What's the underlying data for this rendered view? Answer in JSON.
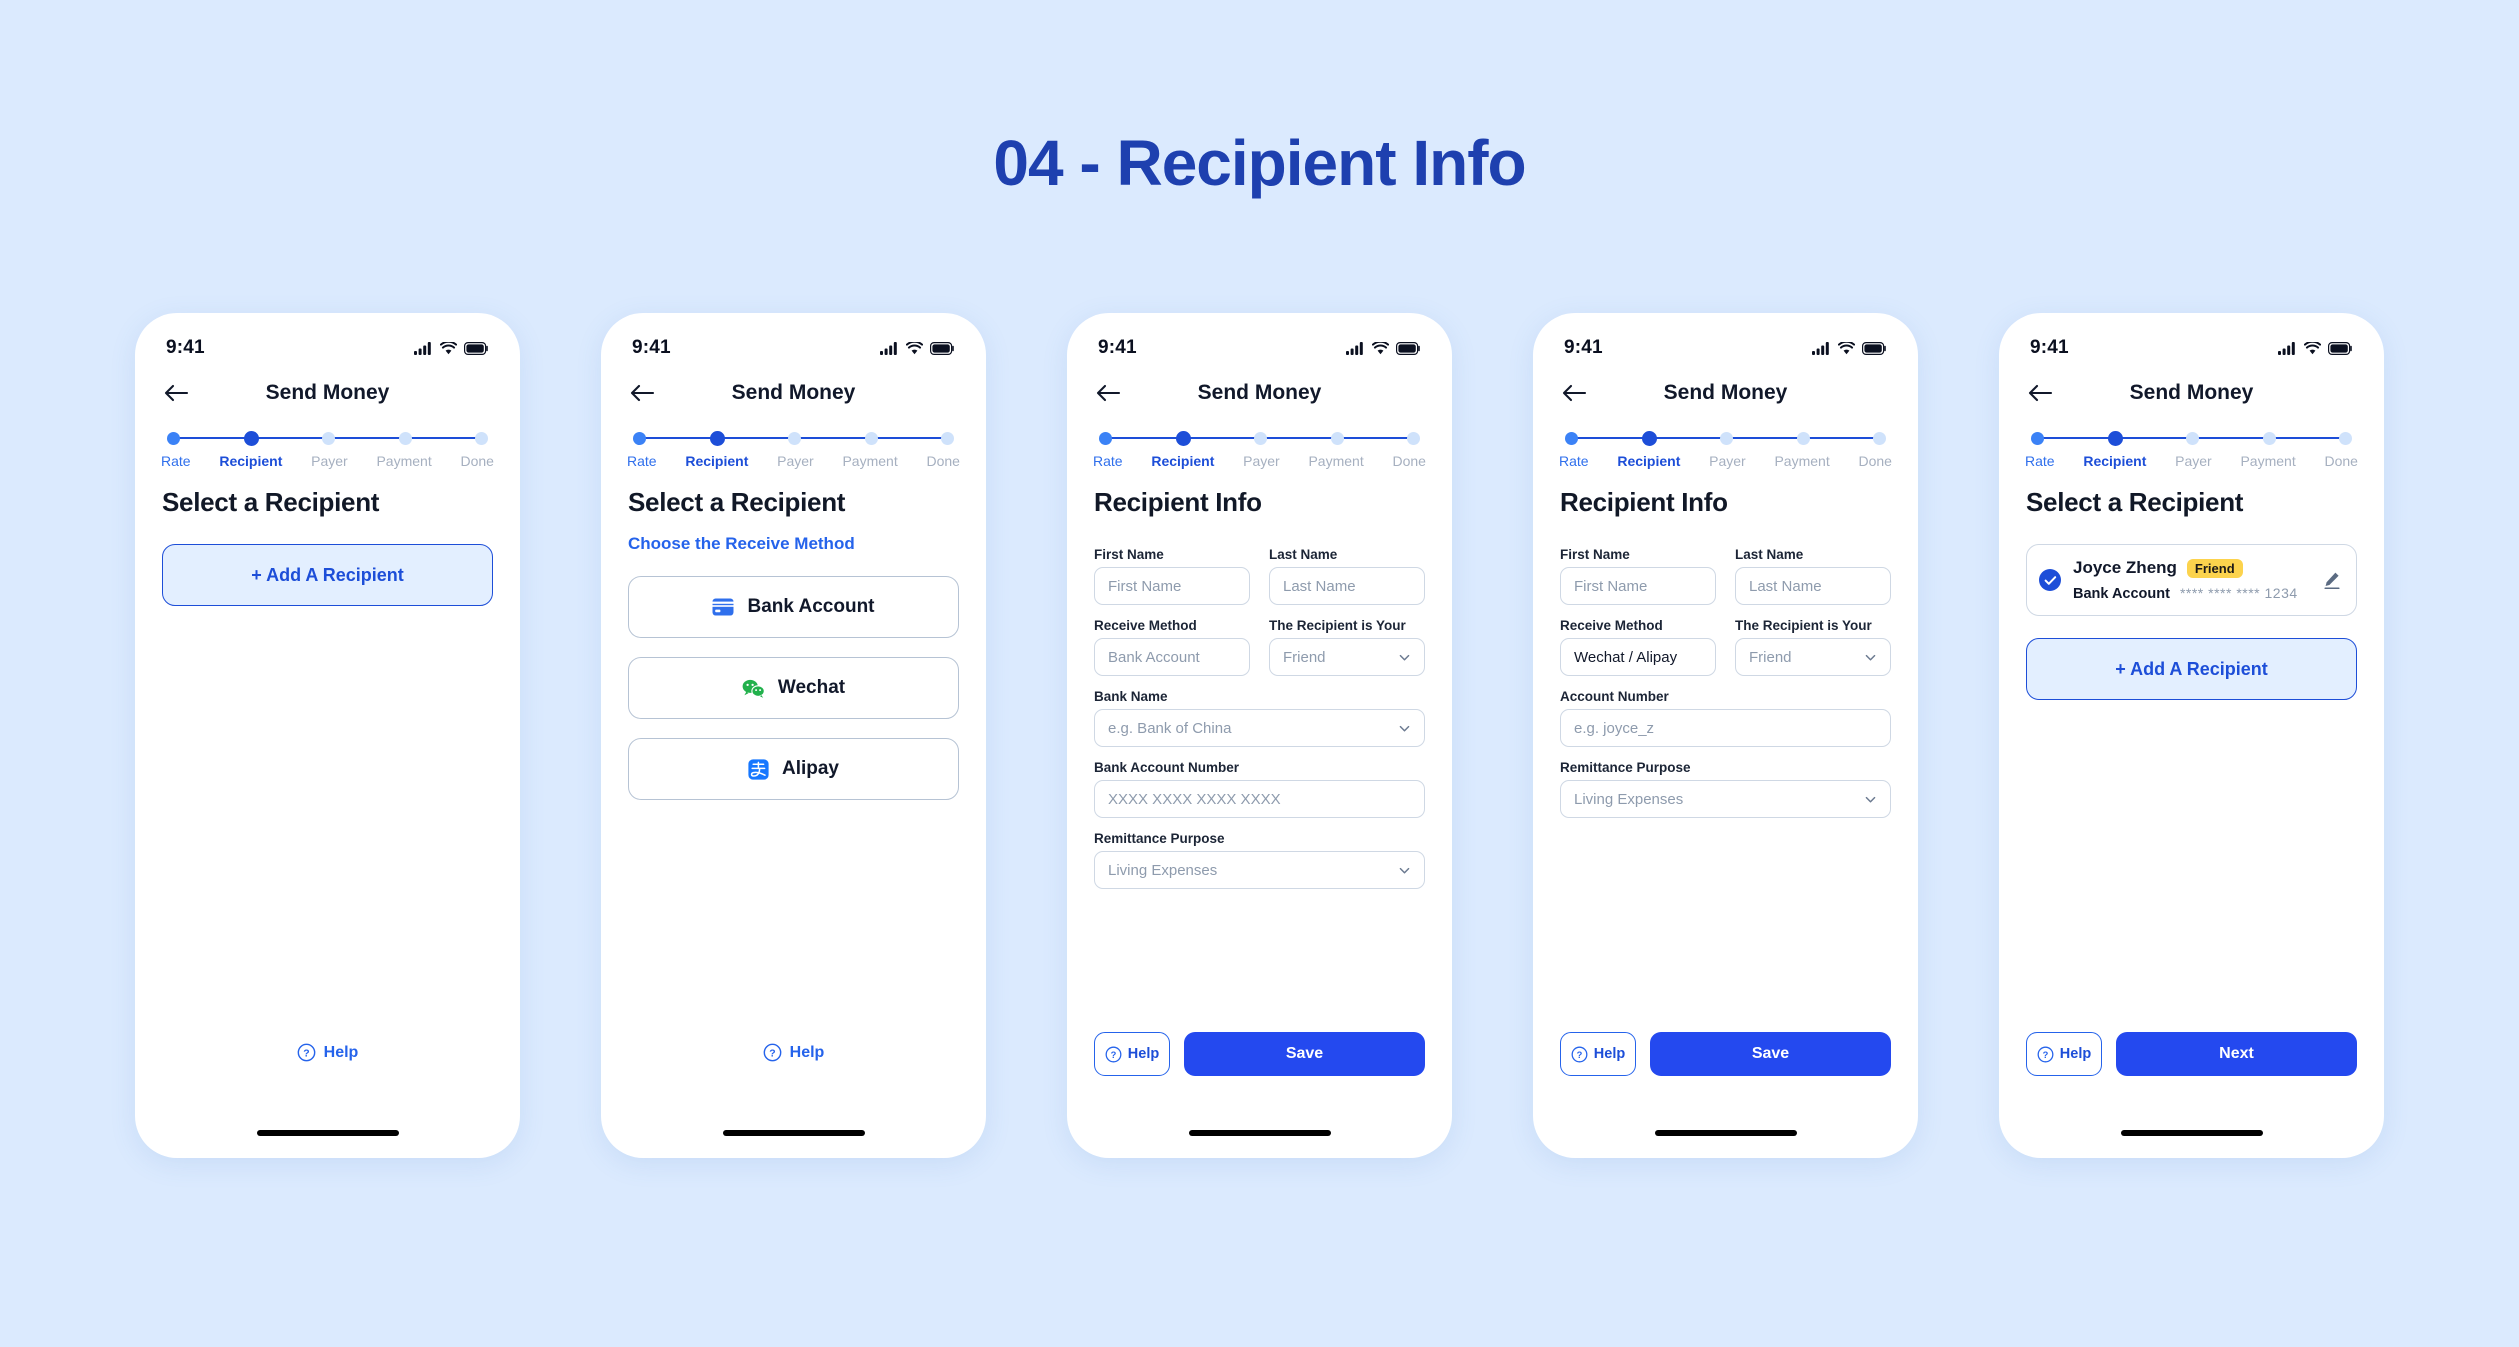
{
  "page": {
    "title": "04 - Recipient Info",
    "background_color": "#dbeafe",
    "title_color": "#1e40af"
  },
  "common": {
    "status_bar": {
      "time": "9:41",
      "icons": [
        "cellular-signal-icon",
        "wifi-icon",
        "battery-icon"
      ]
    },
    "nav": {
      "back_icon": "arrow-left-icon",
      "title": "Send Money"
    },
    "stepper": {
      "steps": [
        {
          "label": "Rate",
          "state": "done"
        },
        {
          "label": "Recipient",
          "state": "current"
        },
        {
          "label": "Payer",
          "state": "todo"
        },
        {
          "label": "Payment",
          "state": "todo"
        },
        {
          "label": "Done",
          "state": "todo"
        }
      ],
      "colors": {
        "done": "#3b82f6",
        "current": "#1d4ed8",
        "todo": "#cfe2fb",
        "line": "#1d4ed8"
      }
    },
    "help_label": "Help",
    "help_icon": "question-circle-icon",
    "add_recipient_label": "+ Add A Recipient",
    "accent_blue": "#2449ef"
  },
  "screens": [
    {
      "id": "select-recipient-empty",
      "heading": "Select a Recipient",
      "add_recipient_label": "+ Add A Recipient"
    },
    {
      "id": "choose-receive-method",
      "heading": "Select a Recipient",
      "subheading": "Choose the Receive Method",
      "methods": [
        {
          "label": "Bank Account",
          "icon": "credit-card-icon",
          "icon_color": "#2f6fec"
        },
        {
          "label": "Wechat",
          "icon": "wechat-icon",
          "icon_color": "#22b14c"
        },
        {
          "label": "Alipay",
          "icon": "alipay-icon",
          "icon_color": "#1677ff"
        }
      ]
    },
    {
      "id": "recipient-info-bank",
      "heading": "Recipient Info",
      "fields": {
        "first_name": {
          "label": "First Name",
          "placeholder": "First Name",
          "value": ""
        },
        "last_name": {
          "label": "Last Name",
          "placeholder": "Last Name",
          "value": ""
        },
        "receive_method": {
          "label": "Receive Method",
          "placeholder": "Bank Account",
          "value": ""
        },
        "recipient_relation": {
          "label": "The Recipient is Your",
          "placeholder": "Friend",
          "value": "",
          "type": "select"
        },
        "bank_name": {
          "label": "Bank Name",
          "placeholder": "e.g. Bank of China",
          "value": "",
          "type": "select"
        },
        "bank_account_number": {
          "label": "Bank Account Number",
          "placeholder": "XXXX XXXX XXXX XXXX",
          "value": ""
        },
        "remittance_purpose": {
          "label": "Remittance Purpose",
          "placeholder": "Living Expenses",
          "value": "",
          "type": "select"
        }
      },
      "actions": {
        "help": "Help",
        "primary": "Save"
      }
    },
    {
      "id": "recipient-info-wallet",
      "heading": "Recipient Info",
      "fields": {
        "first_name": {
          "label": "First Name",
          "placeholder": "First Name",
          "value": ""
        },
        "last_name": {
          "label": "Last Name",
          "placeholder": "Last Name",
          "value": ""
        },
        "receive_method": {
          "label": "Receive Method",
          "placeholder": "",
          "value": "Wechat / Alipay"
        },
        "recipient_relation": {
          "label": "The Recipient is Your",
          "placeholder": "Friend",
          "value": "",
          "type": "select"
        },
        "account_number": {
          "label": "Account Number",
          "placeholder": "e.g. joyce_z",
          "value": ""
        },
        "remittance_purpose": {
          "label": "Remittance Purpose",
          "placeholder": "Living Expenses",
          "value": "",
          "type": "select"
        }
      },
      "actions": {
        "help": "Help",
        "primary": "Save"
      }
    },
    {
      "id": "select-recipient-filled",
      "heading": "Select a Recipient",
      "recipient": {
        "name": "Joyce Zheng",
        "badge": "Friend",
        "account_type": "Bank Account",
        "account_masked": "**** **** **** 1234",
        "selected": true,
        "edit_icon": "pencil-icon",
        "check_icon": "check-icon",
        "badge_color": "#fcd34d"
      },
      "add_recipient_label": "+ Add A Recipient",
      "actions": {
        "help": "Help",
        "primary": "Next"
      }
    }
  ]
}
